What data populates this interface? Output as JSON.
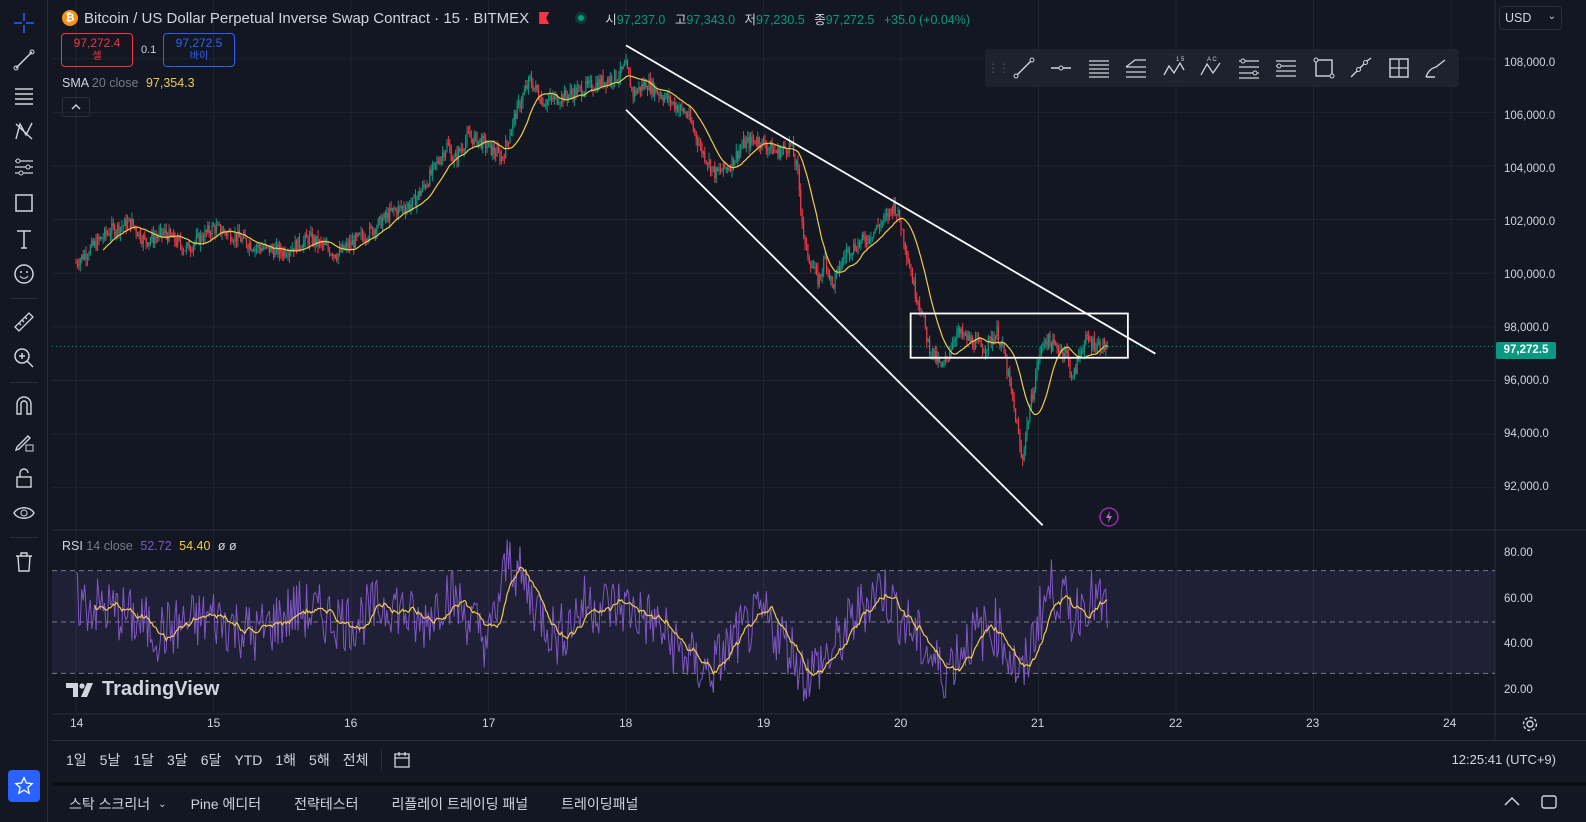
{
  "header": {
    "coin_symbol": "₿",
    "title": "Bitcoin / US Dollar Perpetual Inverse Swap Contract · 15 · BITMEX",
    "ohlc": [
      {
        "k": "시",
        "v": "97,237.0"
      },
      {
        "k": "고",
        "v": "97,343.0"
      },
      {
        "k": "저",
        "v": "97,230.5"
      },
      {
        "k": "종",
        "v": "97,272.5"
      }
    ],
    "change": "+35.0 (+0.04%)",
    "up_color": "#089981",
    "down_color": "#f23645"
  },
  "trade": {
    "sell_price": "97,272.4",
    "sell_label": "셀",
    "spread": "0.1",
    "buy_price": "97,272.5",
    "buy_label": "바이"
  },
  "indicators": {
    "sma": {
      "name": "SMA",
      "params": "20 close",
      "value": "97,354.3",
      "color": "#f0cc4a"
    },
    "rsi": {
      "name": "RSI",
      "params": "14 close",
      "value1": "52.72",
      "value2": "54.40",
      "extra": "ø ø",
      "color": "#7e57c2"
    }
  },
  "currency": "USD",
  "last_price": "97,272.5",
  "price_axis": [
    "108,000.0",
    "106,000.0",
    "104,000.0",
    "102,000.0",
    "100,000.0",
    "98,000.0",
    "96,000.0",
    "94,000.0",
    "92,000.0"
  ],
  "rsi_axis": [
    "80.00",
    "60.00",
    "40.00",
    "20.00"
  ],
  "time_axis": [
    "14",
    "15",
    "16",
    "17",
    "18",
    "19",
    "20",
    "21",
    "22",
    "23",
    "24"
  ],
  "ranges": [
    "1일",
    "5날",
    "1달",
    "3달",
    "6달",
    "YTD",
    "1해",
    "5해",
    "전체"
  ],
  "clock": "12:25:41 (UTC+9)",
  "brand": "TradingView",
  "panels": [
    "스탁 스크리너",
    "Pine 에디터",
    "전략테스터",
    "리플레이 트레이딩 패널",
    "트레이딩패널"
  ],
  "left_tools": [
    "crosshair-icon",
    "trendline-icon",
    "fib-icon",
    "pattern-icon",
    "forecast-icon",
    "shapes-icon",
    "text-icon",
    "emoji-icon",
    "ruler-icon",
    "zoom-icon",
    "magnet-icon",
    "lock-drawing-icon",
    "lock-icon",
    "eye-icon",
    "trash-icon"
  ],
  "draw_tools": [
    "trendline-icon",
    "ray-icon",
    "parallel-channel-icon",
    "flat-channel-icon",
    "xabcd-icon",
    "abcd-icon",
    "fib-retracement-icon",
    "fib-extension-icon",
    "rectangle-icon",
    "path-icon",
    "long-position-icon",
    "brush-icon"
  ],
  "chart_data": {
    "type": "candlestick",
    "symbol": "BTCUSD",
    "interval": "15",
    "ylim": [
      90500,
      108700
    ],
    "rsi_ylim": [
      15,
      85
    ],
    "rsi_bands": [
      70,
      50,
      30
    ],
    "x_days": [
      "14",
      "15",
      "16",
      "17",
      "18",
      "19",
      "20",
      "21",
      "22",
      "23",
      "24"
    ],
    "path_points": [
      [
        14.0,
        100400
      ],
      [
        14.1,
        100900
      ],
      [
        14.25,
        101600
      ],
      [
        14.4,
        101900
      ],
      [
        14.5,
        101200
      ],
      [
        14.65,
        101500
      ],
      [
        14.8,
        100900
      ],
      [
        15.0,
        101700
      ],
      [
        15.15,
        101400
      ],
      [
        15.3,
        101000
      ],
      [
        15.5,
        100800
      ],
      [
        15.7,
        101300
      ],
      [
        15.9,
        100700
      ],
      [
        16.0,
        101100
      ],
      [
        16.15,
        101600
      ],
      [
        16.3,
        102300
      ],
      [
        16.45,
        102600
      ],
      [
        16.55,
        103400
      ],
      [
        16.7,
        104800
      ],
      [
        16.75,
        104200
      ],
      [
        16.85,
        105100
      ],
      [
        16.95,
        104900
      ],
      [
        17.0,
        104700
      ],
      [
        17.1,
        104300
      ],
      [
        17.2,
        106000
      ],
      [
        17.3,
        107200
      ],
      [
        17.4,
        106400
      ],
      [
        17.55,
        106600
      ],
      [
        17.7,
        106900
      ],
      [
        17.8,
        107100
      ],
      [
        17.95,
        107400
      ],
      [
        18.0,
        107700
      ],
      [
        18.05,
        106700
      ],
      [
        18.15,
        107100
      ],
      [
        18.3,
        106500
      ],
      [
        18.45,
        105900
      ],
      [
        18.55,
        104600
      ],
      [
        18.65,
        103700
      ],
      [
        18.75,
        104000
      ],
      [
        18.85,
        104800
      ],
      [
        18.95,
        105000
      ],
      [
        19.1,
        104500
      ],
      [
        19.2,
        104800
      ],
      [
        19.25,
        103700
      ],
      [
        19.3,
        101000
      ],
      [
        19.4,
        99700
      ],
      [
        19.45,
        100600
      ],
      [
        19.5,
        99500
      ],
      [
        19.6,
        100800
      ],
      [
        19.75,
        101300
      ],
      [
        19.9,
        102100
      ],
      [
        19.95,
        102600
      ],
      [
        20.0,
        101800
      ],
      [
        20.1,
        99400
      ],
      [
        20.15,
        98600
      ],
      [
        20.2,
        97300
      ],
      [
        20.3,
        96400
      ],
      [
        20.4,
        97800
      ],
      [
        20.5,
        97500
      ],
      [
        20.6,
        97200
      ],
      [
        20.7,
        97800
      ],
      [
        20.75,
        97000
      ],
      [
        20.8,
        95600
      ],
      [
        20.85,
        94100
      ],
      [
        20.88,
        92900
      ],
      [
        20.9,
        93800
      ],
      [
        20.95,
        95300
      ],
      [
        21.0,
        96800
      ],
      [
        21.05,
        97600
      ],
      [
        21.1,
        97300
      ],
      [
        21.2,
        97100
      ],
      [
        21.25,
        96000
      ],
      [
        21.3,
        97100
      ],
      [
        21.35,
        97500
      ],
      [
        21.45,
        97300
      ],
      [
        21.5,
        97272.5
      ]
    ],
    "rsi_points": [
      [
        14.0,
        58
      ],
      [
        14.3,
        54
      ],
      [
        14.6,
        46
      ],
      [
        15.0,
        52
      ],
      [
        15.3,
        45
      ],
      [
        15.6,
        55
      ],
      [
        16.0,
        50
      ],
      [
        16.3,
        58
      ],
      [
        16.5,
        48
      ],
      [
        16.7,
        62
      ],
      [
        17.0,
        42
      ],
      [
        17.15,
        76
      ],
      [
        17.3,
        60
      ],
      [
        17.5,
        44
      ],
      [
        17.7,
        57
      ],
      [
        18.0,
        56
      ],
      [
        18.2,
        50
      ],
      [
        18.4,
        38
      ],
      [
        18.6,
        30
      ],
      [
        18.8,
        44
      ],
      [
        19.0,
        52
      ],
      [
        19.2,
        40
      ],
      [
        19.3,
        29
      ],
      [
        19.5,
        38
      ],
      [
        19.7,
        55
      ],
      [
        19.85,
        64
      ],
      [
        20.0,
        52
      ],
      [
        20.2,
        38
      ],
      [
        20.3,
        30
      ],
      [
        20.5,
        44
      ],
      [
        20.7,
        48
      ],
      [
        20.8,
        36
      ],
      [
        20.88,
        27
      ],
      [
        21.0,
        52
      ],
      [
        21.1,
        64
      ],
      [
        21.25,
        52
      ],
      [
        21.35,
        60
      ],
      [
        21.5,
        54.4
      ]
    ],
    "rsi_value": 52.72,
    "rsi_ma_value": 54.4,
    "sma_value": 97354.3,
    "last": 97272.5,
    "trendlines": [
      {
        "x1": 18.0,
        "y1": 108500,
        "x2": 21.85,
        "y2": 97000
      },
      {
        "x1": 18.0,
        "y1": 106100,
        "x2": 21.03,
        "y2": 90600
      }
    ],
    "rectangle": {
      "x1": 20.07,
      "y1": 98500,
      "x2": 21.65,
      "y2": 96850
    }
  }
}
